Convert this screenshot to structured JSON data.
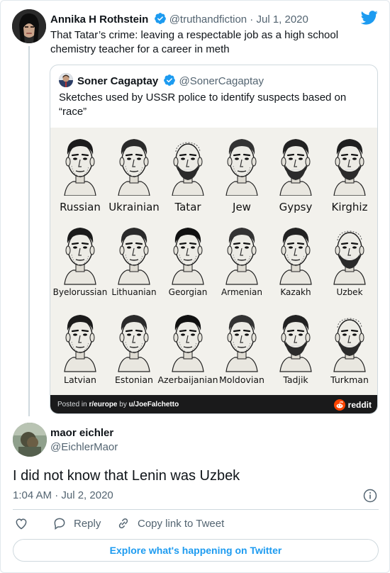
{
  "parent": {
    "name": "Annika H Rothstein",
    "handle": "@truthandfiction · Jul 1, 2020",
    "text": "That Tatar’s crime: leaving a respectable job as a high school chemistry teacher for a career in meth"
  },
  "quote": {
    "name": "Soner Cagaptay",
    "handle": "@SonerCagaptay",
    "text": "Sketches used by USSR police to identify suspects based on “race”",
    "image": {
      "rows": [
        [
          "Russian",
          "Ukrainian",
          "Tatar",
          "Jew",
          "Gypsy",
          "Kirghiz"
        ],
        [
          "Byelorussian",
          "Lithuanian",
          "Georgian",
          "Armenian",
          "Kazakh",
          "Uzbek"
        ],
        [
          "Latvian",
          "Estonian",
          "Azerbaijanian",
          "Moldovian",
          "Tadjik",
          "Turkman"
        ]
      ],
      "footer_prefix": "Posted in ",
      "footer_sub": "r/europe",
      "footer_mid": " by ",
      "footer_user": "u/JoeFalchetto",
      "brand": "reddit"
    }
  },
  "reply": {
    "name": "maor eichler",
    "handle": "@EichlerMaor",
    "text": "I did not know that Lenin was Uzbek",
    "time": "1:04 AM · Jul 2, 2020"
  },
  "actions": {
    "reply": "Reply",
    "copy": "Copy link to Tweet"
  },
  "explore": "Explore what's happening on Twitter",
  "colors": {
    "accent": "#1d9bf0",
    "reddit": "#ff4500"
  }
}
